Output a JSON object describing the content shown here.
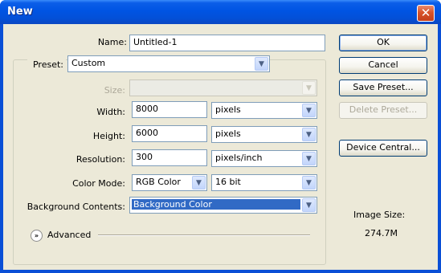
{
  "window": {
    "title": "New",
    "close_glyph": "✕"
  },
  "form": {
    "name_label": "Name:",
    "name_value": "Untitled-1",
    "preset_label": "Preset:",
    "preset_value": "Custom",
    "size_label": "Size:",
    "size_value": "",
    "width_label": "Width:",
    "width_value": "8000",
    "width_unit": "pixels",
    "height_label": "Height:",
    "height_value": "6000",
    "height_unit": "pixels",
    "resolution_label": "Resolution:",
    "resolution_value": "300",
    "resolution_unit": "pixels/inch",
    "colormode_label": "Color Mode:",
    "colormode_value": "RGB Color",
    "bitdepth_value": "16 bit",
    "background_label": "Background Contents:",
    "background_value": "Background Color",
    "advanced_label": "Advanced"
  },
  "buttons": {
    "ok": "OK",
    "cancel": "Cancel",
    "save_preset": "Save Preset...",
    "delete_preset": "Delete Preset...",
    "device_central": "Device Central..."
  },
  "image_size": {
    "label": "Image Size:",
    "value": "274.7M"
  },
  "icons": {
    "dropdown": "chevron-down-icon",
    "advanced": "double-chevron-down-icon",
    "close": "close-icon"
  },
  "colors": {
    "titlebar": "#0054e3",
    "dialog_bg": "#ece9d8",
    "selection": "#316ac5",
    "close_button": "#d8532a"
  }
}
